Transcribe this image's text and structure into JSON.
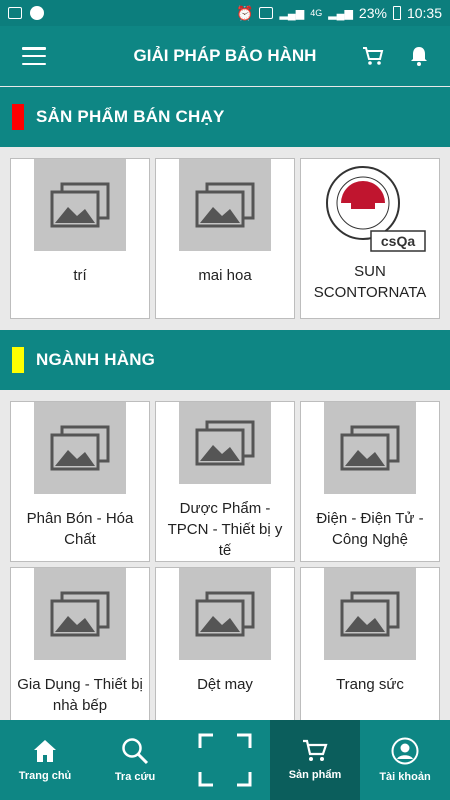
{
  "status_bar": {
    "battery": "23%",
    "time": "10:35",
    "network": "4G"
  },
  "app_bar": {
    "title": "GIẢI PHÁP BẢO HÀNH"
  },
  "bestseller": {
    "title": "SẢN PHẨM BÁN CHẠY",
    "marker_color": "#ff0000",
    "items": [
      {
        "name": "trí"
      },
      {
        "name": "mai hoa"
      },
      {
        "name": "SUN SCONTORNATA"
      }
    ],
    "logo_text": "csQa"
  },
  "categories": {
    "title": "NGÀNH HÀNG",
    "marker_color": "#ffff00",
    "items": [
      {
        "name": "Phân Bón - Hóa Chất"
      },
      {
        "name": "Dược Phẩm - TPCN - Thiết bị y tế"
      },
      {
        "name": "Điện - Điện Tử - Công Nghệ"
      },
      {
        "name": "Gia Dụng - Thiết bị nhà bếp"
      },
      {
        "name": "Dệt may"
      },
      {
        "name": "Trang sức"
      }
    ]
  },
  "bottom_nav": {
    "items": [
      {
        "label": "Trang chủ",
        "icon": "home-icon"
      },
      {
        "label": "Tra cứu",
        "icon": "search-icon"
      },
      {
        "label": "",
        "icon": "scan-icon"
      },
      {
        "label": "Sản phẩm",
        "icon": "cart-icon"
      },
      {
        "label": "Tài khoản",
        "icon": "account-icon"
      }
    ],
    "active_index": 3
  },
  "colors": {
    "primary": "#0e8684",
    "active_tab": "#0b5e5c",
    "placeholder": "#c4c4c4"
  }
}
